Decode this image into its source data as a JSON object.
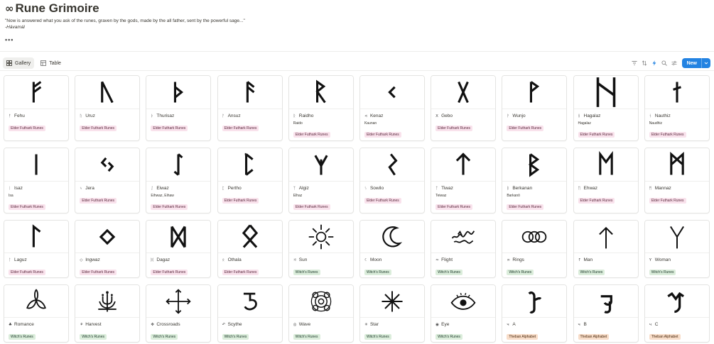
{
  "page": {
    "icon": "∞",
    "title": "Rune Grimoire",
    "quote": "\"Now is answered what you ask of the runes, graven by the gods, made by the all father, sent by the powerful sage...\"",
    "quote_source": "-Hávamál",
    "more": "•••"
  },
  "views": {
    "gallery_label": "Gallery",
    "table_label": "Table"
  },
  "toolbar": {
    "new_label": "New",
    "icons": [
      "filter-icon",
      "sort-icon",
      "lightning-icon",
      "search-icon",
      "customize-icon",
      "chevron-down-icon"
    ]
  },
  "colors": {
    "accent": "#2383e2",
    "tag_pink": "#f9e2ec",
    "tag_green": "#dbeddb",
    "tag_orange": "#f8ddc9"
  },
  "cards": [
    {
      "glyph": "fehu",
      "icon": "ᚠ",
      "name": "Fehu",
      "sub": "",
      "tag": "Elder Futhark Runes",
      "tag_color": "pink"
    },
    {
      "glyph": "uruz",
      "icon": "ᚢ",
      "name": "Uruz",
      "sub": "",
      "tag": "Elder Futhark Runes",
      "tag_color": "pink"
    },
    {
      "glyph": "thurisaz",
      "icon": "ᚦ",
      "name": "Thurisaz",
      "sub": "",
      "tag": "Elder Futhark Runes",
      "tag_color": "pink"
    },
    {
      "glyph": "ansuz",
      "icon": "ᚨ",
      "name": "Ansuz",
      "sub": "",
      "tag": "Elder Futhark Runes",
      "tag_color": "pink"
    },
    {
      "glyph": "raidho",
      "icon": "ᚱ",
      "name": "Raidho",
      "sub": "Raido",
      "tag": "Elder Futhark Runes",
      "tag_color": "pink"
    },
    {
      "glyph": "kenaz",
      "icon": "<",
      "name": "Kenaz",
      "sub": "Kaunan",
      "tag": "Elder Futhark Runes",
      "tag_color": "pink"
    },
    {
      "glyph": "gebo",
      "icon": "X",
      "name": "Gebo",
      "sub": "",
      "tag": "Elder Futhark Runes",
      "tag_color": "pink"
    },
    {
      "glyph": "wunjo",
      "icon": "ᚹ",
      "name": "Wunjo",
      "sub": "",
      "tag": "Elder Futhark Runes",
      "tag_color": "pink"
    },
    {
      "glyph": "hagalaz",
      "icon": "ᚺ",
      "name": "Hagalaz",
      "sub": "Hagalaz",
      "tag": "Elder Futhark Runes",
      "tag_color": "pink"
    },
    {
      "glyph": "nauthiz",
      "icon": "ᚾ",
      "name": "Nauthiz",
      "sub": "Naudhiz",
      "tag": "Elder Futhark Runes",
      "tag_color": "pink"
    },
    {
      "glyph": "isaz",
      "icon": "ᛁ",
      "name": "Isaz",
      "sub": "Isa",
      "tag": "Elder Futhark Runes",
      "tag_color": "pink"
    },
    {
      "glyph": "jera",
      "icon": "ᛃ",
      "name": "Jera",
      "sub": "",
      "tag": "Elder Futhark Runes",
      "tag_color": "pink"
    },
    {
      "glyph": "eiwaz",
      "icon": "ᛇ",
      "name": "Eiwaz",
      "sub": "Eihwaz, Eihaw",
      "tag": "Elder Futhark Runes",
      "tag_color": "pink"
    },
    {
      "glyph": "pertho",
      "icon": "ᛈ",
      "name": "Pertho",
      "sub": "",
      "tag": "Elder Futhark Runes",
      "tag_color": "pink"
    },
    {
      "glyph": "algiz",
      "icon": "ᛉ",
      "name": "Algiz",
      "sub": "Elhaz",
      "tag": "Elder Futhark Runes",
      "tag_color": "pink"
    },
    {
      "glyph": "sowilo",
      "icon": "ᛊ",
      "name": "Sowilo",
      "sub": "",
      "tag": "Elder Futhark Runes",
      "tag_color": "pink"
    },
    {
      "glyph": "tiwaz",
      "icon": "ᛏ",
      "name": "Tiwaz",
      "sub": "Teiwaz",
      "tag": "Elder Futhark Runes",
      "tag_color": "pink"
    },
    {
      "glyph": "berkanan",
      "icon": "ᛒ",
      "name": "Berkanan",
      "sub": "Barkanō",
      "tag": "Elder Futhark Runes",
      "tag_color": "pink"
    },
    {
      "glyph": "ehwaz",
      "icon": "ᛖ",
      "name": "Ehwaz",
      "sub": "",
      "tag": "Elder Futhark Runes",
      "tag_color": "pink"
    },
    {
      "glyph": "mannaz",
      "icon": "ᛗ",
      "name": "Mannaz",
      "sub": "",
      "tag": "Elder Futhark Runes",
      "tag_color": "pink"
    },
    {
      "glyph": "laguz",
      "icon": "ᛚ",
      "name": "Laguz",
      "sub": "",
      "tag": "Elder Futhark Runes",
      "tag_color": "pink"
    },
    {
      "glyph": "ingwaz",
      "icon": "◇",
      "name": "Ingwaz",
      "sub": "",
      "tag": "Elder Futhark Runes",
      "tag_color": "pink"
    },
    {
      "glyph": "dagaz",
      "icon": "ᛞ",
      "name": "Dagaz",
      "sub": "",
      "tag": "Elder Futhark Runes",
      "tag_color": "pink"
    },
    {
      "glyph": "othala",
      "icon": "ᛟ",
      "name": "Othala",
      "sub": "",
      "tag": "Elder Futhark Runes",
      "tag_color": "pink"
    },
    {
      "glyph": "sun",
      "icon": "☼",
      "name": "Sun",
      "sub": "",
      "tag": "Witch's Runes",
      "tag_color": "green"
    },
    {
      "glyph": "moon",
      "icon": "☾",
      "name": "Moon",
      "sub": "",
      "tag": "Witch's Runes",
      "tag_color": "green"
    },
    {
      "glyph": "flight",
      "icon": "≈",
      "name": "Flight",
      "sub": "",
      "tag": "Witch's Runes",
      "tag_color": "green"
    },
    {
      "glyph": "rings",
      "icon": "∞",
      "name": "Rings",
      "sub": "",
      "tag": "Witch's Runes",
      "tag_color": "green"
    },
    {
      "glyph": "man",
      "icon": "↑",
      "name": "Man",
      "sub": "",
      "tag": "Witch's Runes",
      "tag_color": "green"
    },
    {
      "glyph": "woman",
      "icon": "Y",
      "name": "Woman",
      "sub": "",
      "tag": "Witch's Runes",
      "tag_color": "green"
    },
    {
      "glyph": "romance",
      "icon": "♣",
      "name": "Romance",
      "sub": "",
      "tag": "Witch's Runes",
      "tag_color": "green"
    },
    {
      "glyph": "harvest",
      "icon": "⚘",
      "name": "Harvest",
      "sub": "",
      "tag": "Witch's Runes",
      "tag_color": "green"
    },
    {
      "glyph": "crossroads",
      "icon": "✥",
      "name": "Crossroads",
      "sub": "",
      "tag": "Witch's Runes",
      "tag_color": "green"
    },
    {
      "glyph": "scythe",
      "icon": "↶",
      "name": "Scythe",
      "sub": "",
      "tag": "Witch's Runes",
      "tag_color": "green"
    },
    {
      "glyph": "wave",
      "icon": "◎",
      "name": "Wave",
      "sub": "",
      "tag": "Witch's Runes",
      "tag_color": "green"
    },
    {
      "glyph": "star",
      "icon": "✳",
      "name": "Star",
      "sub": "",
      "tag": "Witch's Runes",
      "tag_color": "green"
    },
    {
      "glyph": "eye",
      "icon": "◉",
      "name": "Eye",
      "sub": "",
      "tag": "Witch's Runes",
      "tag_color": "green"
    },
    {
      "glyph": "theban-a",
      "icon": "ч",
      "name": "A",
      "sub": "",
      "tag": "Theban Alphabet",
      "tag_color": "orange"
    },
    {
      "glyph": "theban-b",
      "icon": "ч",
      "name": "B",
      "sub": "",
      "tag": "Theban Alphabet",
      "tag_color": "orange"
    },
    {
      "glyph": "theban-c",
      "icon": "ч",
      "name": "C",
      "sub": "",
      "tag": "Theban Alphabet",
      "tag_color": "orange"
    }
  ]
}
